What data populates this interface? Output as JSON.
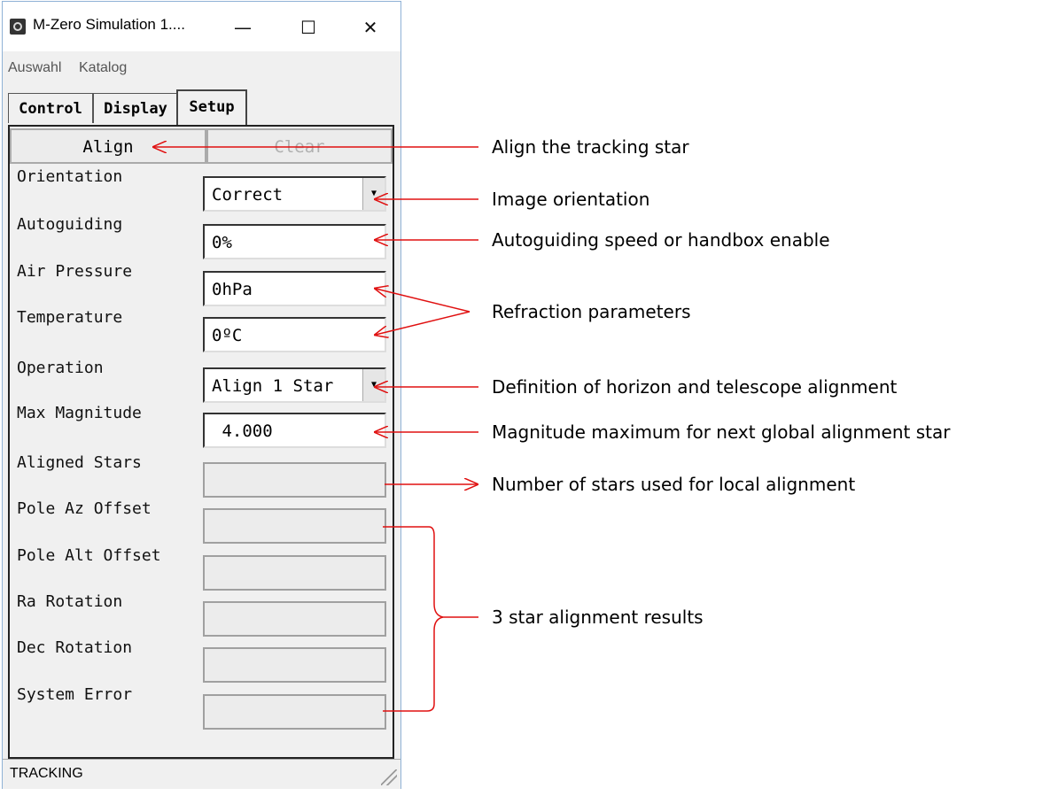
{
  "window": {
    "title": "M-Zero Simulation 1....",
    "minimize": "—",
    "maximize": "☐",
    "close": "✕"
  },
  "menu": [
    "Auswahl",
    "Katalog"
  ],
  "tabs": [
    "Control",
    "Display",
    "Setup"
  ],
  "active_tab": "Setup",
  "buttons": {
    "align": "Align",
    "clear": "Clear"
  },
  "fields": [
    {
      "label": "Orientation",
      "value": "Correct",
      "type": "combo"
    },
    {
      "label": "Autoguiding",
      "value": "0%",
      "type": "edit"
    },
    {
      "label": "Air Pressure",
      "value": "0hPa",
      "type": "edit"
    },
    {
      "label": "Temperature",
      "value": "0ºC",
      "type": "edit"
    },
    {
      "label": "Operation",
      "value": "Align 1 Star",
      "type": "combo"
    },
    {
      "label": "Max Magnitude",
      "value": " 4.000",
      "type": "edit"
    },
    {
      "label": "Aligned Stars",
      "value": "",
      "type": "readonly"
    },
    {
      "label": "Pole Az Offset",
      "value": "",
      "type": "readonly"
    },
    {
      "label": "Pole Alt Offset",
      "value": "",
      "type": "readonly"
    },
    {
      "label": "Ra Rotation",
      "value": "",
      "type": "readonly"
    },
    {
      "label": "Dec Rotation",
      "value": "",
      "type": "readonly"
    },
    {
      "label": "System Error",
      "value": "",
      "type": "readonly"
    }
  ],
  "status": "TRACKING",
  "annotations": {
    "align": "Align the tracking star",
    "orientation": "Image orientation",
    "autoguiding": "Autoguiding speed or handbox enable",
    "refraction": "Refraction parameters",
    "operation": "Definition of horizon and telescope alignment",
    "magnitude": "Magnitude maximum for next global alignment star",
    "aligned_stars": "Number of stars used for local alignment",
    "results": "3 star alignment results"
  },
  "colors": {
    "arrow": "#e01010",
    "disabled_text": "#b0b0b0"
  }
}
